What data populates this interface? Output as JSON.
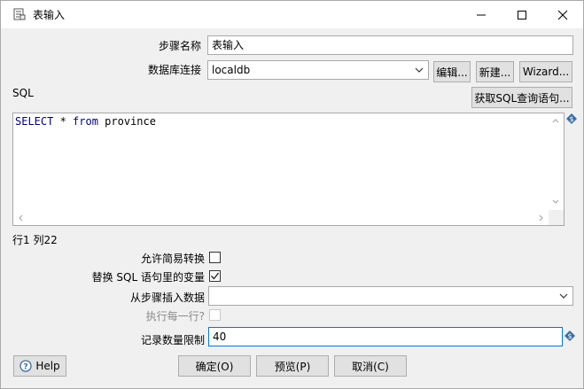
{
  "window": {
    "title": "表输入",
    "icon": "table-input-icon",
    "controls": [
      "minimize-icon",
      "maximize-icon",
      "close-icon"
    ]
  },
  "form": {
    "step_name_label": "步骤名称",
    "step_name_value": "表输入",
    "db_connection_label": "数据库连接",
    "db_connection_value": "localdb",
    "edit_button": "编辑...",
    "new_button": "新建...",
    "wizard_button": "Wizard...",
    "sql_label": "SQL",
    "get_sql_button": "获取SQL查询语句...",
    "sql": {
      "kw1": "SELECT",
      "mid": " * ",
      "kw2": "from",
      "rest": " province"
    },
    "cursor_position": "行1 列22",
    "lazy_conversion_label": "允许简易转换",
    "lazy_conversion_checked": false,
    "replace_vars_label": "替换 SQL 语句里的变量",
    "replace_vars_checked": true,
    "insert_from_step_label": "从步骤插入数据",
    "insert_from_step_value": "",
    "execute_each_row_label": "执行每一行?",
    "execute_each_row_checked": false,
    "execute_each_row_enabled": false,
    "limit_label": "记录数量限制",
    "limit_value": "40"
  },
  "footer": {
    "help_button": "Help",
    "ok_button": "确定(O)",
    "preview_button": "预览(P)",
    "cancel_button": "取消(C)"
  },
  "colors": {
    "sql_keyword": "#000080",
    "variable_icon": "#3a6ea5",
    "focus_border": "#0078d7"
  }
}
